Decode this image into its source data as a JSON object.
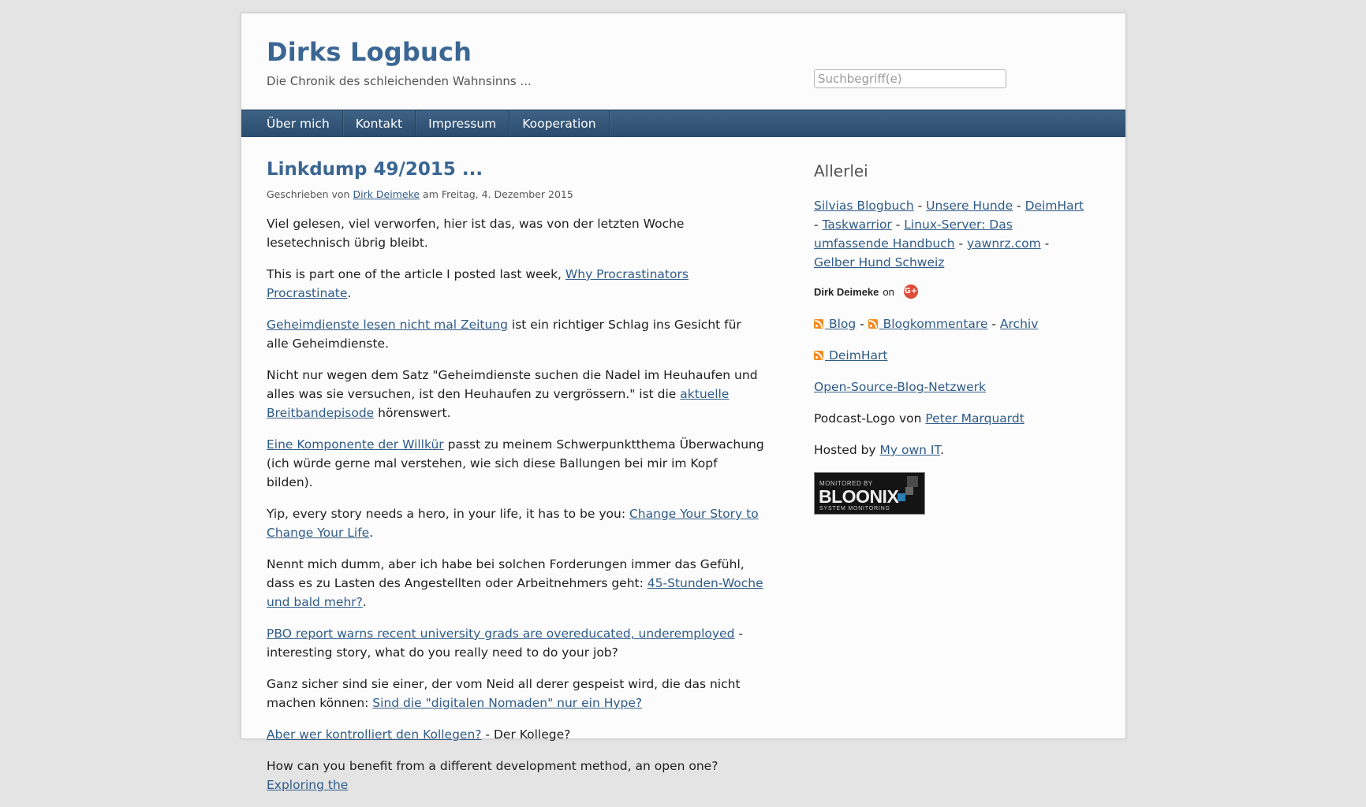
{
  "site": {
    "title": "Dirks Logbuch",
    "tagline": "Die Chronik des schleichenden Wahnsinns ..."
  },
  "search": {
    "placeholder": "Suchbegriff(e)"
  },
  "nav": [
    "Über mich",
    "Kontakt",
    "Impressum",
    "Kooperation"
  ],
  "post": {
    "title": "Linkdump 49/2015 ...",
    "byline_prefix": "Geschrieben von",
    "author": "Dirk Deimeke",
    "byline_date": "am Freitag, 4. Dezember 2015",
    "p1": "Viel gelesen, viel verworfen, hier ist das, was von der letzten Woche lesetechnisch übrig bleibt.",
    "p2_pre": "This is part one of the article I posted last week, ",
    "p2_link": "Why Procrastinators Procrastinate",
    "p2_post": ".",
    "p3_link": "Geheimdienste lesen nicht mal Zeitung",
    "p3_post": " ist ein richtiger Schlag ins Gesicht für alle Geheimdienste.",
    "p4_pre": "Nicht nur wegen dem Satz \"Geheimdienste suchen die Nadel im Heuhaufen und alles was sie versuchen, ist den Heuhaufen zu vergrössern.\" ist die ",
    "p4_link": "aktuelle Breitbandepisode",
    "p4_post": " hörenswert.",
    "p5_link": "Eine Komponente der Willkür",
    "p5_post": " passt zu meinem Schwerpunktthema Überwachung (ich würde gerne mal verstehen, wie sich diese Ballungen bei mir im Kopf bilden).",
    "p6_pre": "Yip, every story needs a hero, in your life, it has to be you: ",
    "p6_link": "Change Your Story to Change Your Life",
    "p6_post": ".",
    "p7_pre": "Nennt mich dumm, aber ich habe bei solchen Forderungen immer das Gefühl, dass es zu Lasten des Angestellten oder Arbeitnehmers geht: ",
    "p7_link": "45-Stunden-Woche und bald mehr?",
    "p7_post": ".",
    "p8_link": "PBO report warns recent university grads are overeducated, underemployed",
    "p8_post": " - interesting story, what do you really need to do your job?",
    "p9_pre": "Ganz sicher sind sie einer, der vom Neid all derer gespeist wird, die das nicht machen können: ",
    "p9_link": "Sind die \"digitalen Nomaden\" nur ein Hype?",
    "p10_link": "Aber wer kontrolliert den Kollegen?",
    "p10_post": " - Der Kollege?",
    "p11_pre": "How can you benefit from a different development method, an open one? ",
    "p11_link": "Exploring the"
  },
  "sidebar": {
    "title": "Allerlei",
    "links1": [
      "Silvias Blogbuch",
      "Unsere Hunde",
      "DeimHart",
      "Taskwarrior",
      "Linux-Server: Das umfassende Handbuch",
      "yawnrz.com",
      "Gelber Hund Schweiz"
    ],
    "sep": " - ",
    "gplus_name": "Dirk Deimeke",
    "gplus_on": "on",
    "gplus_glyph": "G+",
    "feeds": [
      "Blog",
      "Blogkommentare",
      "Archiv"
    ],
    "feed2": "DeimHart",
    "network": "Open-Source-Blog-Netzwerk",
    "logo_pre": "Podcast-Logo von ",
    "logo_link": "Peter Marquardt",
    "hosted_pre": "Hosted by ",
    "hosted_link": "My own IT",
    "hosted_post": ".",
    "badge_top": "MONITORED BY",
    "badge_brand": "BLOONIX",
    "badge_bottom": "SYSTEM MONITORING",
    "colors": {
      "link": "#2f5b88",
      "title": "#3a6693",
      "nav": "#2f5274",
      "rss": "#f38b1e",
      "gplus": "#dd4b39"
    }
  }
}
